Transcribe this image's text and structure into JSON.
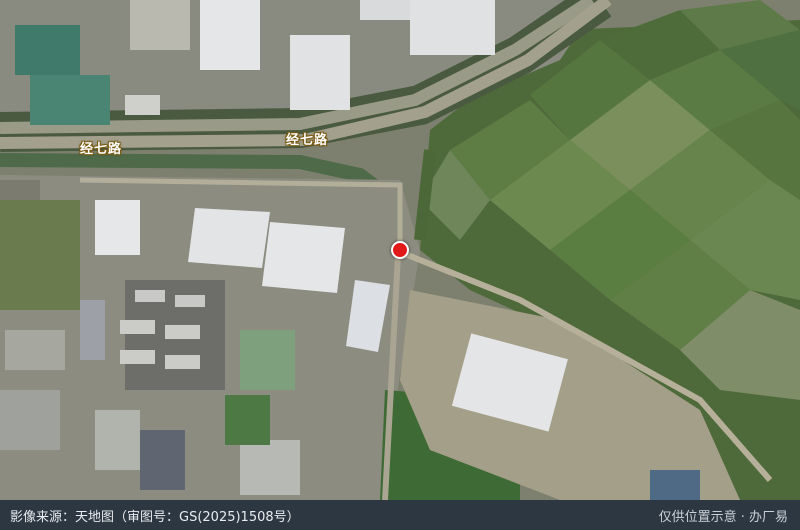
{
  "map": {
    "road_labels": [
      "经七路",
      "经七路"
    ],
    "marker_label": "location-marker"
  },
  "footer": {
    "imagery_source": "影像来源：天地图（审图号：GS(2025)1508号）",
    "disclaimer": "仅供位置示意 · 办厂易"
  },
  "colors": {
    "marker": "#e11919",
    "footer_bg": "#2d3742",
    "road_label_text": "#ffffff"
  }
}
